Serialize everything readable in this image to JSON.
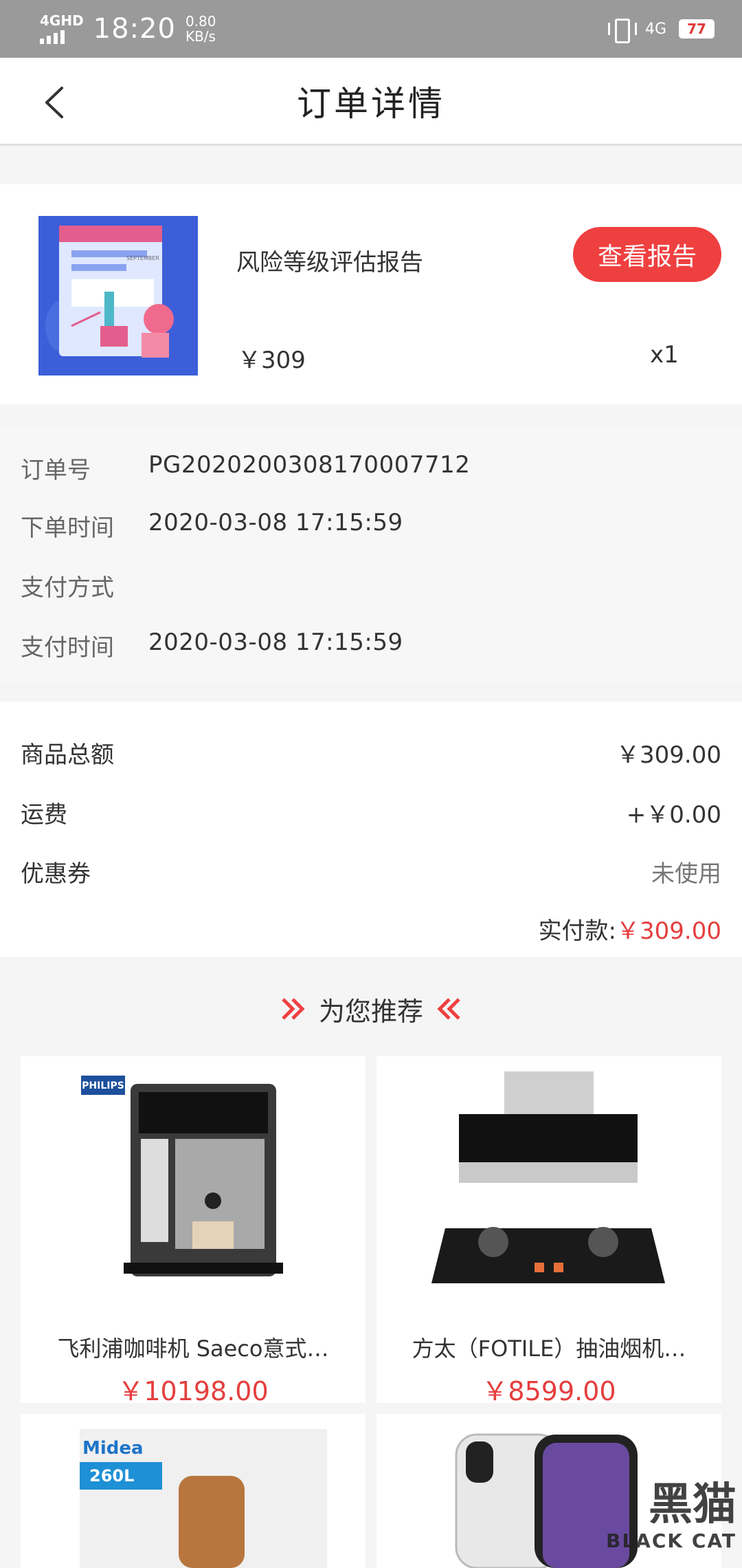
{
  "status_bar": {
    "network": "4GHD",
    "time": "18:20",
    "speed_value": "0.80",
    "speed_unit": "KB/s",
    "network_right": "4G",
    "battery": "77"
  },
  "nav": {
    "title": "订单详情",
    "back_icon": "chevron-left-icon"
  },
  "product": {
    "name": "风险等级评估报告",
    "button_label": "查看报告",
    "price": "￥309",
    "quantity": "x1",
    "thumb_text": "SEPTEMBER",
    "button_color": "#ef4040"
  },
  "order_info": {
    "rows": [
      {
        "label": "订单号",
        "value": "PG2020200308170007712"
      },
      {
        "label": "下单时间",
        "value": "2020-03-08 17:15:59"
      },
      {
        "label": "支付方式",
        "value": ""
      },
      {
        "label": "支付时间",
        "value": "2020-03-08 17:15:59"
      }
    ]
  },
  "amounts": {
    "rows": [
      {
        "label": "商品总额",
        "value": "￥309.00"
      },
      {
        "label": "运费",
        "value": "+￥0.00"
      },
      {
        "label": "优惠券",
        "value": "未使用"
      }
    ],
    "paid_label": "实付款:",
    "paid_value": "￥309.00"
  },
  "recommend": {
    "title": "为您推荐",
    "items": [
      {
        "name": "飞利浦咖啡机 Saeco意式…",
        "price": "￥10198.00",
        "brand": "PHILIPS"
      },
      {
        "name": "方太（FOTILE）抽油烟机…",
        "price": "￥8599.00",
        "brand": ""
      },
      {
        "name": "",
        "price": "",
        "brand": "Midea",
        "badge": "260L"
      },
      {
        "name": "",
        "price": "",
        "brand": ""
      }
    ]
  },
  "watermark": {
    "cjk": "黑猫",
    "latin": "BLACK CAT"
  },
  "colors": {
    "accent": "#e53e3e",
    "status_bar": "#9a9a9a"
  }
}
